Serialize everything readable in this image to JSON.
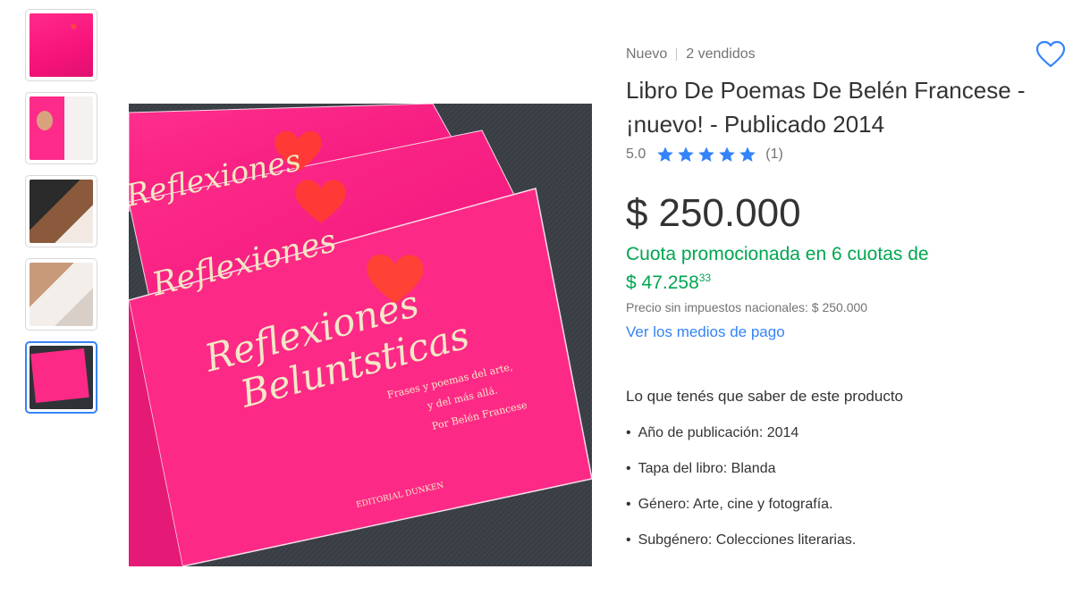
{
  "header": {
    "condition": "Nuevo",
    "sold": "2 vendidos"
  },
  "product": {
    "title": "Libro De Poemas De Belén Francese - ¡nuevo! - Publicado 2014",
    "rating_value": "5.0",
    "rating_count": "(1)",
    "stars": 5,
    "price_currency": "$",
    "price_amount": "250.000",
    "installments_text": "Cuota promocionada en 6 cuotas de",
    "installments_amount": "$ 47.258",
    "installments_cents": "33",
    "tax_note": "Precio sin impuestos nacionales: $ 250.000",
    "payment_link": "Ver los medios de pago"
  },
  "details": {
    "heading": "Lo que tenés que saber de este producto",
    "items": [
      "Año de publicación: 2014",
      "Tapa del libro: Blanda",
      "Género: Arte, cine y fotografía.",
      "Subgénero: Colecciones literarias."
    ]
  },
  "cover": {
    "title_line1": "Reflexiones",
    "title_line2": "Beluntsticas",
    "subtitle_line1": "Frases y poemas del arte,",
    "subtitle_line2": "y del más allá.",
    "author": "Por Belén Francese",
    "publisher": "EDITORIAL DUNKEN"
  },
  "gallery": {
    "thumbnail_count": 5,
    "selected_index": 4
  },
  "colors": {
    "accent_blue": "#3483fa",
    "promo_green": "#00a650",
    "cover_pink": "#fc2a86",
    "heart_red": "#ff4136"
  }
}
